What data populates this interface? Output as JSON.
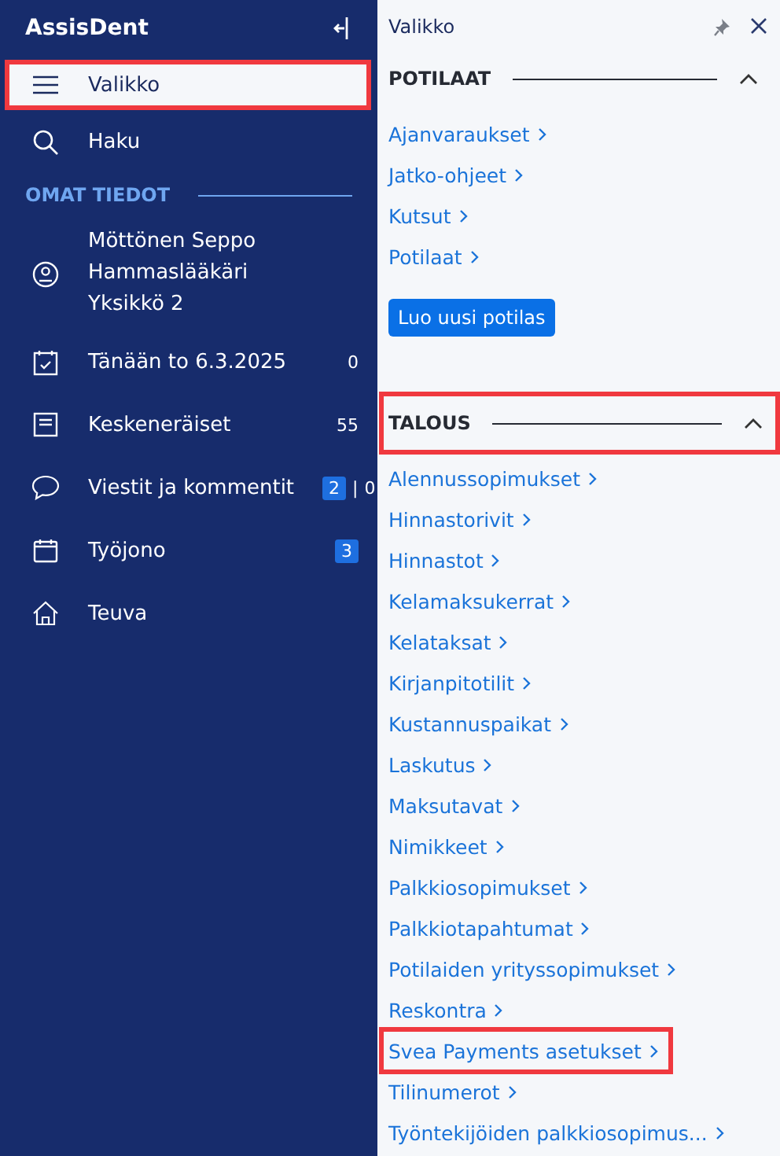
{
  "sidebar": {
    "app_title": "AssisDent",
    "items": [
      {
        "kind": "menu",
        "label": "Valikko",
        "selected": true,
        "highlighted": true
      },
      {
        "kind": "search",
        "label": "Haku",
        "selected": false,
        "highlighted": false
      }
    ],
    "section": {
      "title": "OMAT TIEDOT",
      "items": [
        {
          "kind": "user",
          "lines": [
            "Möttönen Seppo",
            "Hammaslääkäri",
            "Yksikkö 2"
          ],
          "selected": false
        },
        {
          "kind": "today",
          "label": "Tänään to 6.3.2025",
          "count": "0",
          "selected": false
        },
        {
          "kind": "drafts",
          "label": "Keskeneräiset",
          "count": "55",
          "selected": false
        },
        {
          "kind": "messages",
          "label": "Viestit ja kommentit",
          "badge": "2",
          "separator": "|",
          "count": "0",
          "selected": false
        },
        {
          "kind": "queue",
          "label": "Työjono",
          "badge": "3",
          "selected": false
        },
        {
          "kind": "unit",
          "label": "Teuva",
          "selected": false
        }
      ]
    }
  },
  "panel": {
    "title": "Valikko",
    "sections": [
      {
        "title": "POTILAAT",
        "expanded": true,
        "highlighted": false,
        "links": [
          {
            "label": "Ajanvaraukset",
            "highlighted": false
          },
          {
            "label": "Jatko-ohjeet",
            "highlighted": false
          },
          {
            "label": "Kutsut",
            "highlighted": false
          },
          {
            "label": "Potilaat",
            "highlighted": false
          }
        ],
        "button": "Luo uusi potilas"
      },
      {
        "title": "TALOUS",
        "expanded": true,
        "highlighted": true,
        "links": [
          {
            "label": "Alennussopimukset",
            "highlighted": false
          },
          {
            "label": "Hinnastorivit",
            "highlighted": false
          },
          {
            "label": "Hinnastot",
            "highlighted": false
          },
          {
            "label": "Kelamaksukerrat",
            "highlighted": false
          },
          {
            "label": "Kelataksat",
            "highlighted": false
          },
          {
            "label": "Kirjanpitotilit",
            "highlighted": false
          },
          {
            "label": "Kustannuspaikat",
            "highlighted": false
          },
          {
            "label": "Laskutus",
            "highlighted": false
          },
          {
            "label": "Maksutavat",
            "highlighted": false
          },
          {
            "label": "Nimikkeet",
            "highlighted": false
          },
          {
            "label": "Palkkiosopimukset",
            "highlighted": false
          },
          {
            "label": "Palkkiotapahtumat",
            "highlighted": false
          },
          {
            "label": "Potilaiden yrityssopimukset",
            "highlighted": false
          },
          {
            "label": "Reskontra",
            "highlighted": false
          },
          {
            "label": "Svea Payments asetukset",
            "highlighted": true
          },
          {
            "label": "Tilinumerot",
            "highlighted": false
          },
          {
            "label": "Työntekijöiden palkkiosopimus...",
            "highlighted": false
          }
        ]
      }
    ]
  }
}
